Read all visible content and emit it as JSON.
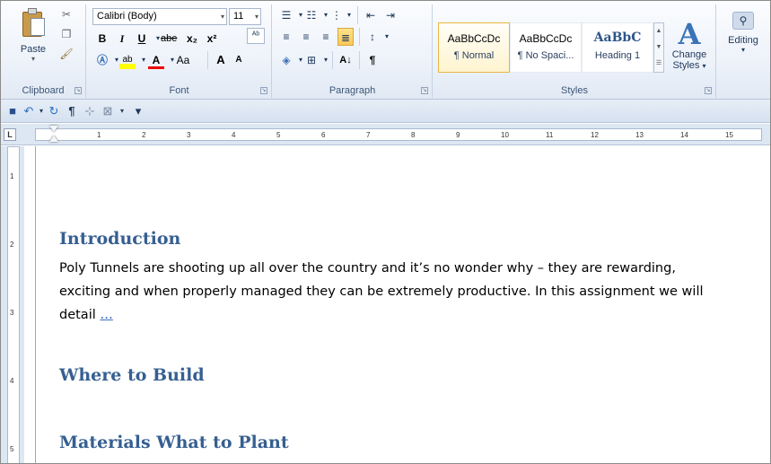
{
  "ribbon": {
    "clipboard": {
      "label": "Clipboard",
      "paste_label": "Paste",
      "cut_icon": "scissors-icon",
      "copy_icon": "copy-icon",
      "format_painter_icon": "brush-icon"
    },
    "font": {
      "label": "Font",
      "font_name": "Calibri (Body)",
      "font_size": "11",
      "bold": "B",
      "italic": "I",
      "underline": "U",
      "strikethrough": "abe",
      "subscript": "x₂",
      "superscript": "x²",
      "change_case": "Aa",
      "grow_font": "A",
      "shrink_font": "A"
    },
    "paragraph": {
      "label": "Paragraph",
      "pilcrow": "¶"
    },
    "styles": {
      "label": "Styles",
      "items": [
        {
          "sample": "AaBbCcDc",
          "name": "¶ Normal"
        },
        {
          "sample": "AaBbCcDc",
          "name": "¶ No Spaci..."
        },
        {
          "sample": "AaBbC",
          "name": "Heading 1"
        }
      ],
      "change_styles_line1": "Change",
      "change_styles_line2": "Styles"
    },
    "editing": {
      "label": "Editing"
    }
  },
  "ruler_numbers": [
    "1",
    "2",
    "3",
    "4",
    "5",
    "6",
    "7",
    "8",
    "9",
    "10",
    "11",
    "12",
    "13",
    "14",
    "15"
  ],
  "vruler_numbers": [
    "1",
    "2",
    "3",
    "4",
    "5"
  ],
  "tab_selector": "L",
  "document": {
    "headings": [
      "Introduction",
      "Where to Build",
      "Materials What to Plant"
    ],
    "intro_lines": [
      "Poly Tunnels are shooting up all over the country and it’s no wonder why – they are rewarding,",
      "exciting and when properly managed they can be extremely productive.  In this assignment we will",
      "detail "
    ],
    "ellipsis": "…"
  },
  "colors": {
    "heading": "#365f91",
    "ribbon_border": "#b6c4d8",
    "accent_selected": "#e8b73f"
  }
}
